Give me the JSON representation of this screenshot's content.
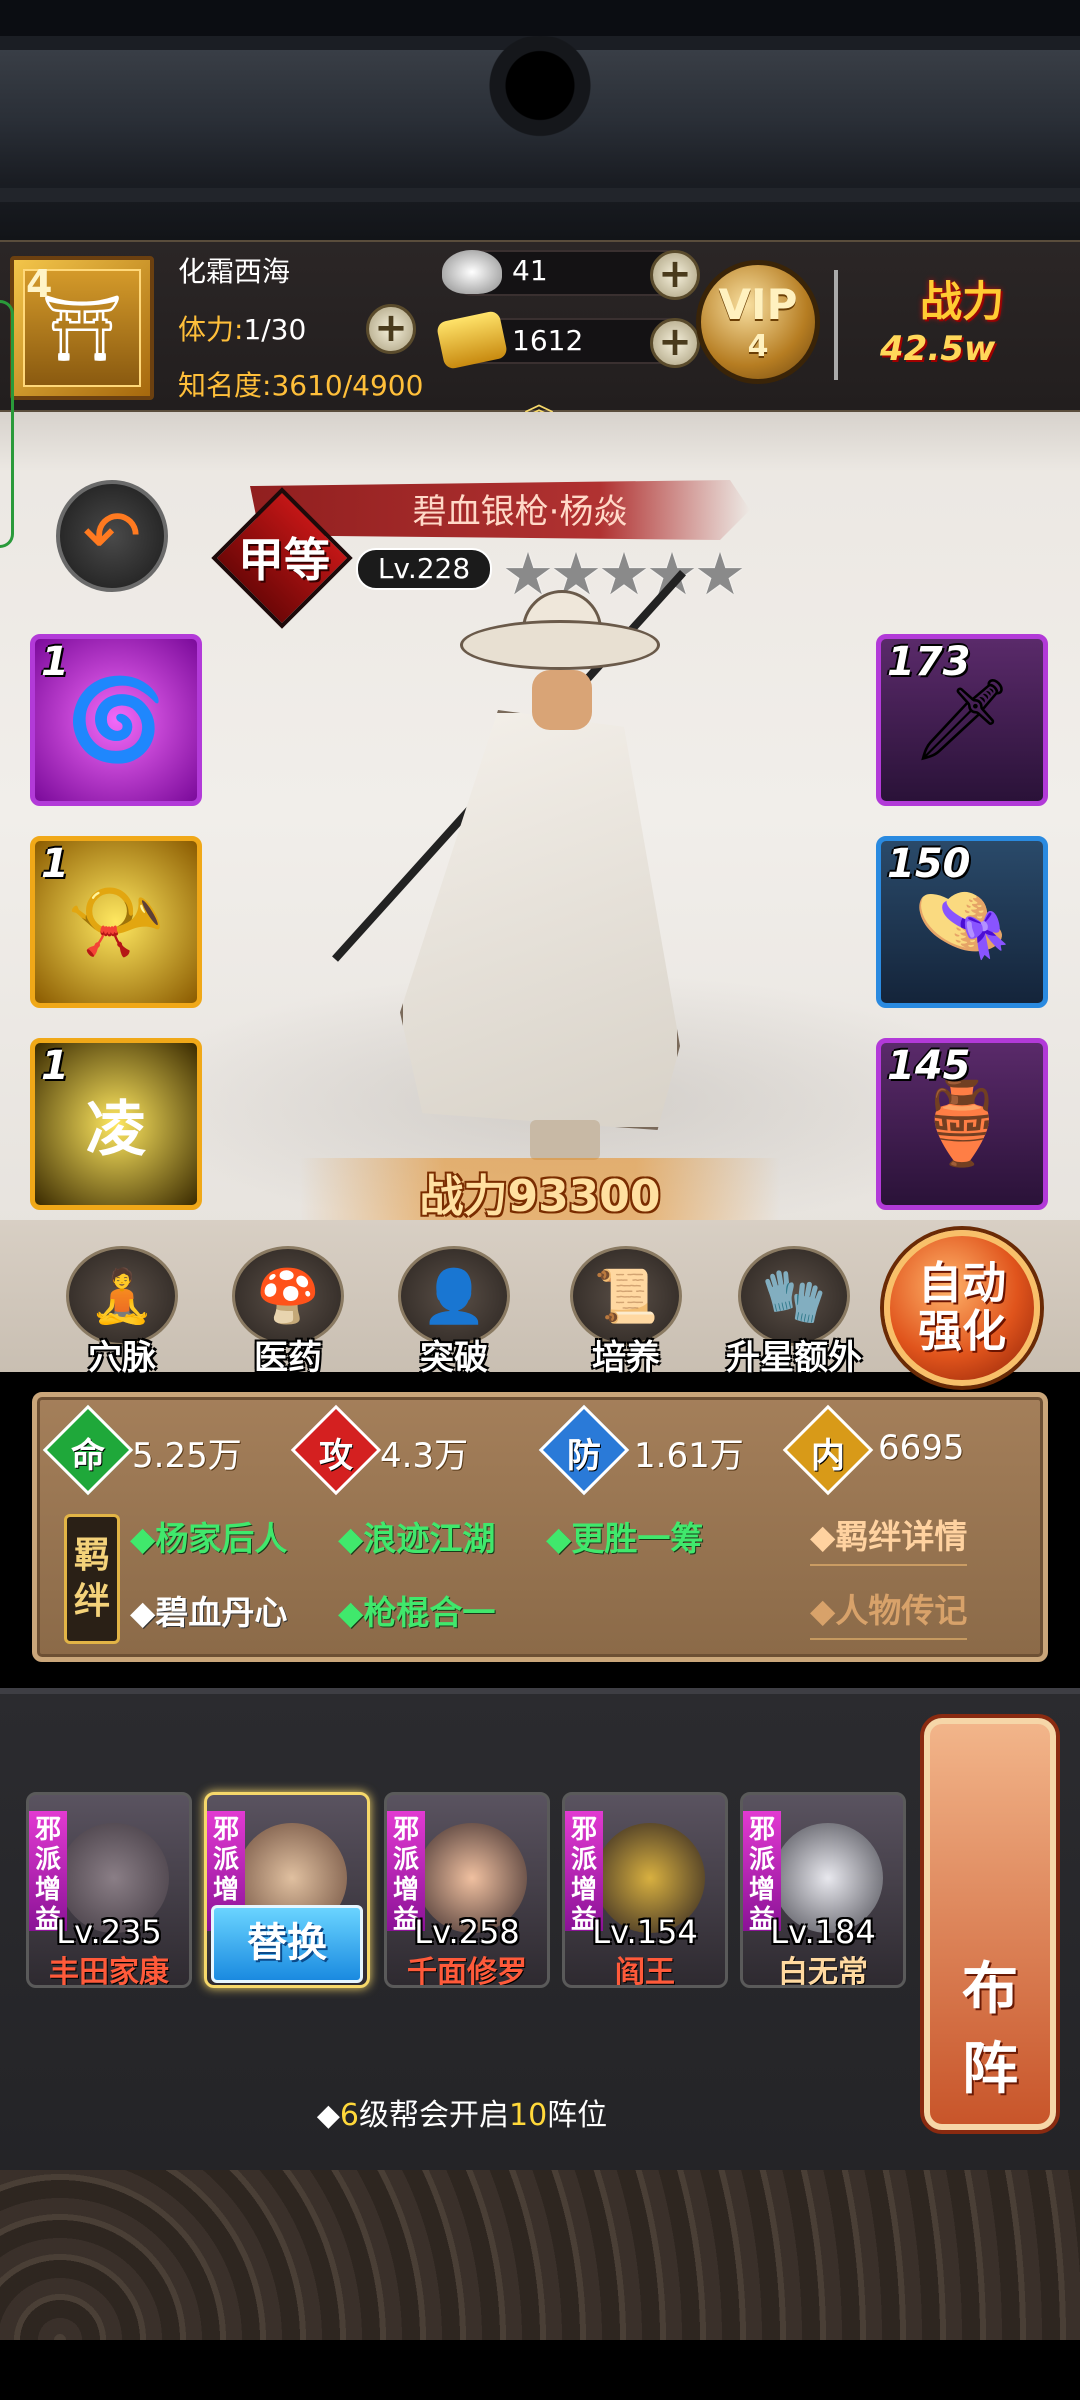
{
  "guild": {
    "level": "4",
    "name": "化霜西海"
  },
  "stamina": {
    "label": "体力:",
    "value": "1/30"
  },
  "fame": {
    "label": "知名度:",
    "value": "3610/4900"
  },
  "silver": {
    "value": "41"
  },
  "gold": {
    "value": "1612"
  },
  "vip": {
    "label": "VIP",
    "level": "4"
  },
  "top_power": {
    "label": "战力",
    "value": "42.5w"
  },
  "hero": {
    "name": "碧血银枪·杨焱",
    "grade": "甲等",
    "level": "Lv.228",
    "stars": "★★★★★",
    "power_label": "战力",
    "power": "93300"
  },
  "skills": [
    {
      "level": "1",
      "icon": "purple-vortex-icon"
    },
    {
      "level": "1",
      "icon": "golden-horn-icon"
    },
    {
      "level": "1",
      "icon": "boot-skill-icon",
      "glyph": "凌"
    }
  ],
  "equipment": [
    {
      "level": "173",
      "icon": "spear-icon"
    },
    {
      "level": "150",
      "icon": "straw-hat-icon"
    },
    {
      "level": "145",
      "icon": "wine-pot-icon"
    }
  ],
  "actions": [
    {
      "label": "穴脉",
      "icon": "meridian-icon"
    },
    {
      "label": "医药",
      "icon": "medicine-icon"
    },
    {
      "label": "突破",
      "icon": "breakthrough-icon"
    },
    {
      "label": "培养",
      "icon": "training-scroll-icon"
    },
    {
      "label": "升星额外",
      "icon": "star-upgrade-icon"
    }
  ],
  "auto_enhance": {
    "line1": "自动",
    "line2": "强化"
  },
  "stats": [
    {
      "icon": "命",
      "value": "5.25万",
      "color": "#1fa83a"
    },
    {
      "icon": "攻",
      "value": "4.3万",
      "color": "#d42020"
    },
    {
      "icon": "防",
      "value": "1.61万",
      "color": "#2a7ad8"
    },
    {
      "icon": "内",
      "value": "6695",
      "color": "#d89a18"
    }
  ],
  "bond_tag": "羁绊",
  "bonds": [
    {
      "text": "◆杨家后人",
      "active": true
    },
    {
      "text": "◆浪迹江湖",
      "active": true
    },
    {
      "text": "◆更胜一筹",
      "active": true
    },
    {
      "text": "◆碧血丹心",
      "active": false
    },
    {
      "text": "◆枪棍合一",
      "active": true
    }
  ],
  "links": {
    "bond_detail": "◆羁绊详情",
    "biography": "◆人物传记"
  },
  "lineup": [
    {
      "tag": "邪派增益",
      "level": "Lv.235",
      "name": "丰田家康"
    },
    {
      "tag": "邪派增益",
      "level": "",
      "name": "",
      "selected": true
    },
    {
      "tag": "邪派增益",
      "level": "Lv.258",
      "name": "千面修罗"
    },
    {
      "tag": "邪派增益",
      "level": "Lv.154",
      "name": "阎王"
    },
    {
      "tag": "邪派增益",
      "level": "Lv.184",
      "name": "白无常"
    }
  ],
  "replace_label": "替换",
  "formation": {
    "line1": "布",
    "line2": "阵"
  },
  "hint": {
    "prefix": "◆",
    "num1": "6",
    "mid": "级帮会开启",
    "num2": "10",
    "suffix": "阵位"
  }
}
